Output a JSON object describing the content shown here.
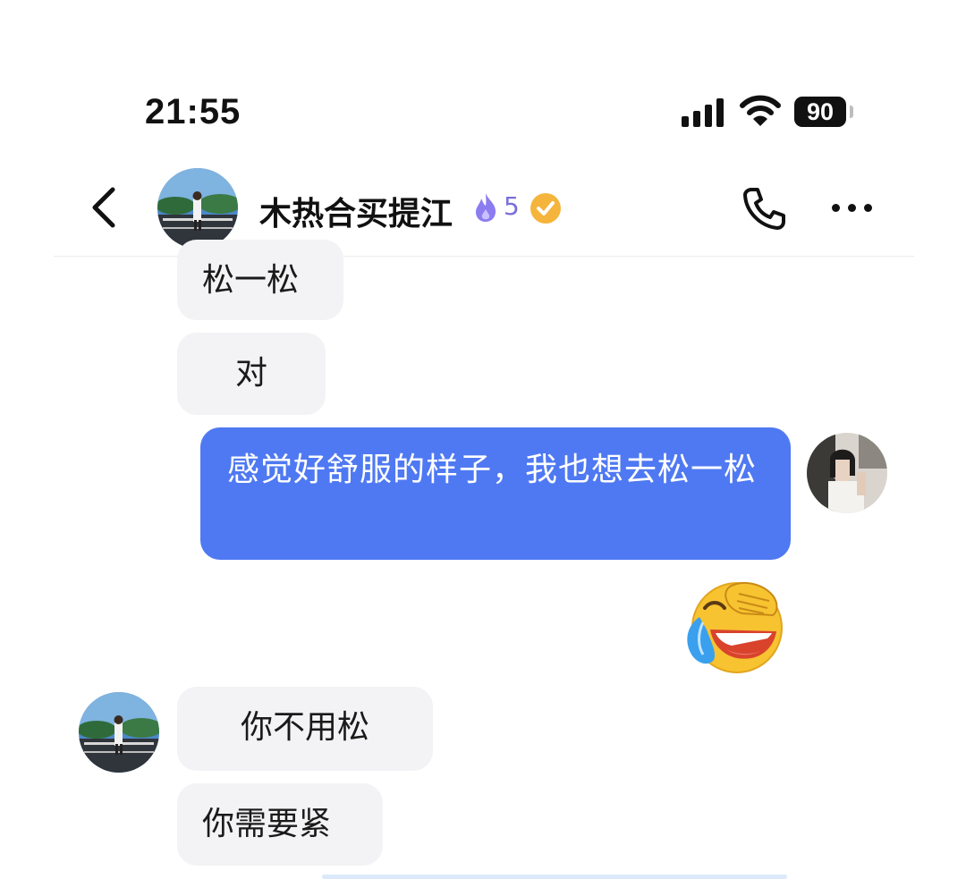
{
  "status_bar": {
    "time": "21:55",
    "signal_icon": "cellular-signal-icon",
    "wifi_icon": "wifi-icon",
    "battery_level": "90"
  },
  "header": {
    "back_icon": "chevron-left-icon",
    "contact_name": "木热合买提江",
    "streak_icon": "flame-icon",
    "streak_count": "5",
    "verified_icon": "check-badge-icon",
    "call_icon": "phone-icon",
    "more_icon": "more-dots-icon"
  },
  "messages": [
    {
      "from": "peer",
      "text": "松一松"
    },
    {
      "from": "peer",
      "text": "对"
    },
    {
      "from": "self",
      "text": "感觉好舒服的样子，我也想去松一松"
    },
    {
      "from": "self",
      "type": "emoji",
      "emoji": "laughing-crying-emoji"
    },
    {
      "from": "peer",
      "text": "你不用松"
    },
    {
      "from": "peer",
      "text": "你需要紧"
    }
  ],
  "colors": {
    "outgoing_bubble": "#4f79f2",
    "incoming_bubble": "#f3f3f5",
    "streak_flame": "#8b7cf0",
    "verified_badge": "#f5b43c"
  }
}
